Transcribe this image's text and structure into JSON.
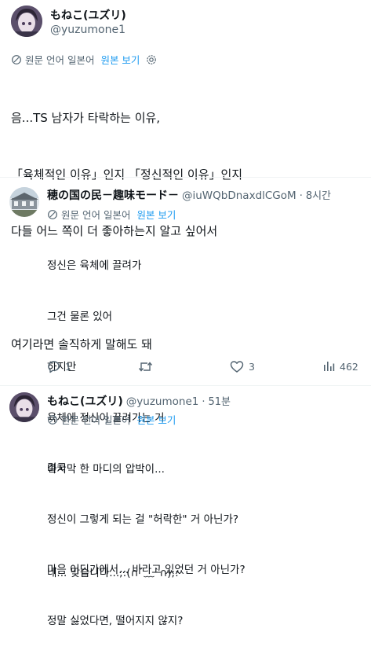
{
  "main_tweet": {
    "display_name": "もねこ(ユズリ)",
    "handle": "@yuzumone1",
    "translate_label": "원문 언어 일본어",
    "translate_link": "원본 보기",
    "lines": [
      "음...TS 남자가 타락하는 이유,",
      "「육체적인 이유」인지 「정신적인 이유」인지",
      "다들 어느 쪽이 더 좋아하는지 알고 싶어서",
      "",
      "여기라면 솔직하게 말해도 돼"
    ]
  },
  "reply_1": {
    "display_name": "穂の国の民－趣味モード－",
    "handle": "@iuWQbDnaxdlCGoM",
    "separator": "·",
    "time": "8시간",
    "translate_label": "원문 언어 일본어",
    "translate_link": "원본 보기",
    "lines": [
      "정신은 육체에 끌려가",
      "그건 물론 있어",
      "하지만",
      "육체에 정신이 끌려가는 거",
      "결국",
      "정신이 그렇게 되는 걸 \"허락한\" 거 아닌가?",
      "마음 어딘가에서... 바라고 있었던 거 아닌가?",
      "정말 싫었다면, 떨어지지 않지?"
    ],
    "actions": {
      "reply_count": "1",
      "retweet_count": "",
      "like_count": "3",
      "view_count": "462"
    }
  },
  "reply_2": {
    "display_name": "もねこ(ユズリ)",
    "handle": "@yuzumone1",
    "separator": "·",
    "time": "51분",
    "translate_label": "원문 언어 일본어",
    "translate_link": "원본 보기",
    "lines": [
      "마지막 한 마디의 압박이...",
      "",
      "네... 맞습니다...;:(∩´﹏`∩);:"
    ]
  },
  "colors": {
    "text": "#0f1419",
    "muted": "#536471",
    "link": "#1d9bf0",
    "divider": "#eff3f4"
  },
  "icons": [
    "translate-icon",
    "settings-icon",
    "reply-icon",
    "retweet-icon",
    "like-icon",
    "views-icon"
  ]
}
